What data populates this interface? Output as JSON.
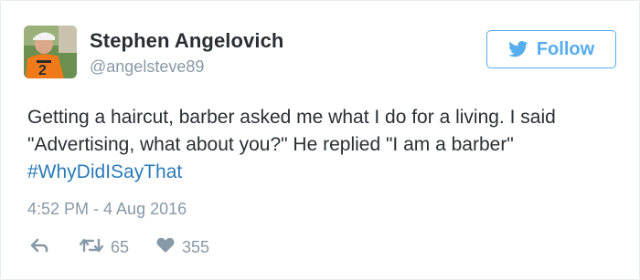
{
  "user": {
    "name": "Stephen Angelovich",
    "handle": "@angelsteve89"
  },
  "follow_button": {
    "label": "Follow"
  },
  "tweet": {
    "text_main": "Getting a haircut, barber asked me what I do for a living. I said \"Advertising, what about you?\" He replied \"I am a barber\" ",
    "hashtag": "#WhyDidISayThat",
    "timestamp": "4:52 PM - 4 Aug 2016"
  },
  "actions": {
    "retweets": "65",
    "likes": "355"
  },
  "colors": {
    "accent": "#55acee",
    "hashtag": "#2b7bb9",
    "secondary_text": "#8899a6",
    "primary_text": "#292f33"
  },
  "icons": {
    "follow": "twitter-bird-icon",
    "reply": "reply-icon",
    "retweet": "retweet-icon",
    "like": "heart-icon"
  }
}
